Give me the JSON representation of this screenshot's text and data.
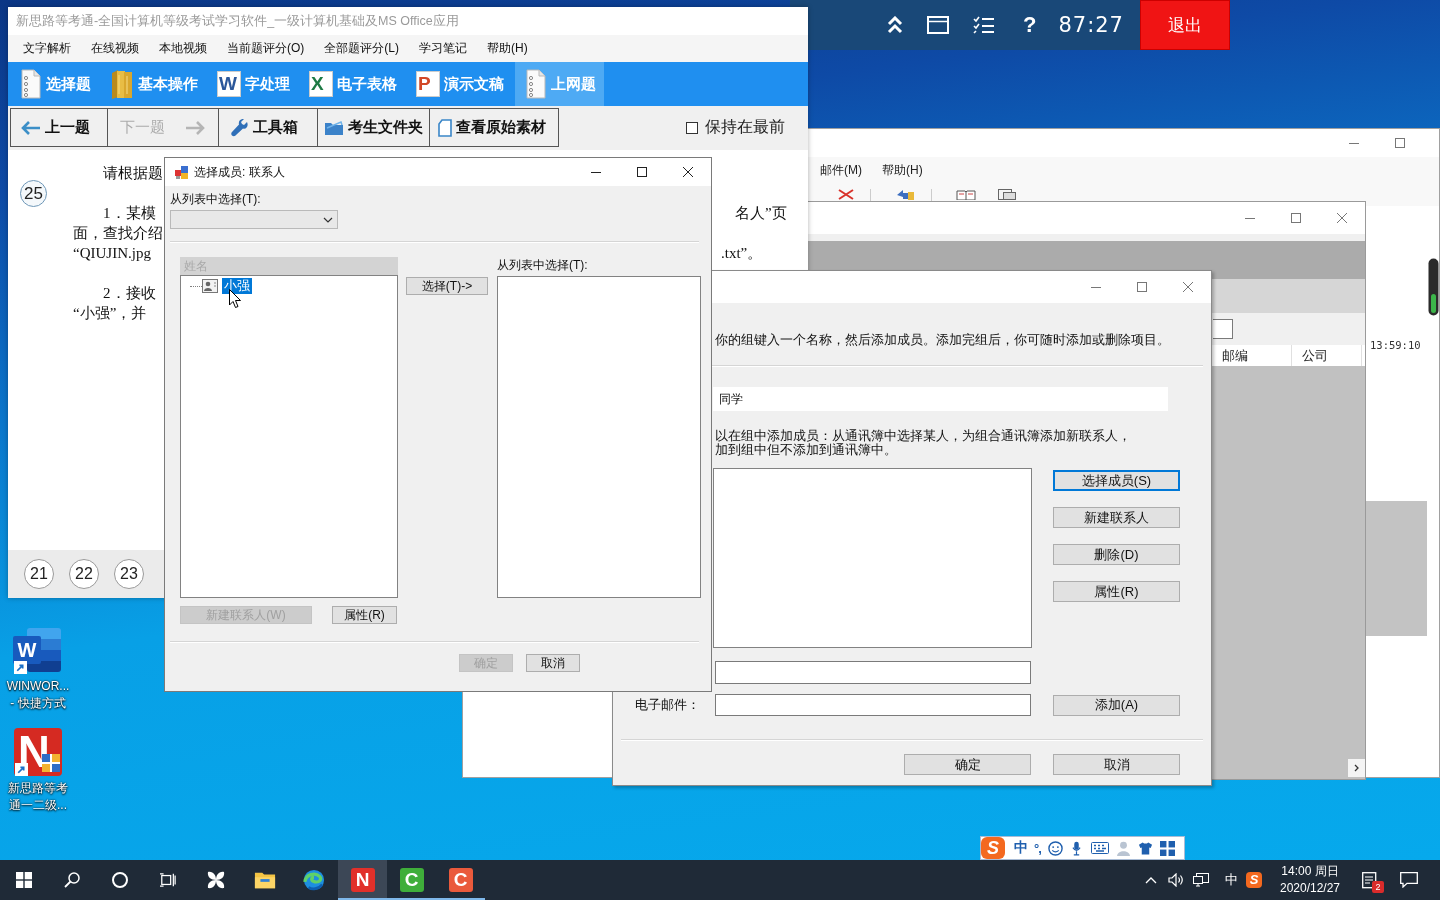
{
  "desktop": {
    "icons": [
      {
        "kind": "word",
        "glyph": "W",
        "lines": [
          "WINWOR...",
          "- 快捷方式"
        ]
      },
      {
        "kind": "exam-app",
        "glyph": "N",
        "lines": [
          "新思路等考",
          "通一二级..."
        ]
      }
    ]
  },
  "exam_bar": {
    "help": "?",
    "timer": "87:27",
    "exit": "退出"
  },
  "mail_window": {
    "menu": [
      "邮件(M)",
      "帮助(H)"
    ],
    "time": "13:59:10"
  },
  "address_book": {
    "columns": [
      "邮编",
      "公司"
    ]
  },
  "group_dialog": {
    "intro": "你的组键入一个名称，然后添加成员。添加完组后，你可随时添加或删除项目。",
    "name_value": "同学",
    "hint_lines": [
      "以在组中添加成员：从通讯簿中选择某人，为组合通讯簿添加新联系人，",
      "加到组中但不添加到通讯簿中。"
    ],
    "side_buttons": [
      {
        "label": "选择成员(S)",
        "focused": true
      },
      {
        "label": "新建联系人",
        "focused": false
      },
      {
        "label": "删除(D)",
        "focused": false
      },
      {
        "label": "属性(R)",
        "focused": false
      }
    ],
    "email_label": "电子邮件：",
    "add_button": "添加(A)",
    "footer_buttons": [
      "确定",
      "取消"
    ]
  },
  "app_window": {
    "title": "新思路等考通-全国计算机等级考试学习软件_一级计算机基础及MS Office应用",
    "menu": [
      "文字解析",
      "在线视频",
      "本地视频",
      "当前题评分(O)",
      "全部题评分(L)",
      "学习笔记",
      "帮助(H)"
    ],
    "tabs": [
      {
        "label": "选择题",
        "kind": "page",
        "selected": false
      },
      {
        "label": "基本操作",
        "kind": "folder",
        "selected": false
      },
      {
        "label": "字处理",
        "kind": "word",
        "glyph": "W",
        "selected": false
      },
      {
        "label": "电子表格",
        "kind": "excel",
        "glyph": "X",
        "selected": false
      },
      {
        "label": "演示文稿",
        "kind": "ppt",
        "glyph": "P",
        "selected": false
      },
      {
        "label": "上网题",
        "kind": "page",
        "selected": true
      }
    ],
    "toolbar": [
      {
        "label": "上一题",
        "kind": "prev",
        "disabled": false
      },
      {
        "label": "下一题",
        "kind": "next",
        "disabled": true
      },
      {
        "label": "工具箱",
        "kind": "tools",
        "disabled": false
      },
      {
        "label": "考生文件夹",
        "kind": "folder",
        "disabled": false
      },
      {
        "label": "查看原始素材",
        "kind": "source",
        "disabled": false
      }
    ],
    "keep_on_top": {
      "label": "保持在最前",
      "checked": false
    },
    "question": {
      "number": "25",
      "paragraphs": [
        [
          "请根据题"
        ],
        [
          "1．某模",
          "面，查找介绍",
          "“QIUJIN.jpg"
        ],
        [
          "2．接收",
          "“小强”，并"
        ]
      ],
      "right_fragments": [
        "名人”页",
        ".txt”。"
      ]
    },
    "nav": [
      "21",
      "22",
      "23"
    ]
  },
  "select_dialog": {
    "title": "选择成员: 联系人",
    "list_label": "从列表中选择(T):",
    "column": "姓名",
    "contacts": [
      {
        "name": "小强",
        "selected": true
      }
    ],
    "select_button": "选择(T)->",
    "members_label": "从列表中选择(T):",
    "buttons": [
      {
        "label": "新建联系人(W)",
        "disabled": true
      },
      {
        "label": "属性(R)",
        "disabled": false
      }
    ],
    "footer_buttons": [
      {
        "label": "确定",
        "disabled": true
      },
      {
        "label": "取消",
        "disabled": false
      }
    ]
  },
  "ime_bar": {
    "glyph": "S",
    "mode": "中",
    "punctuation": "°,"
  },
  "taskbar": {
    "apps": [
      {
        "kind": "folder",
        "running": false,
        "active": false
      },
      {
        "kind": "browser",
        "running": false,
        "active": false
      },
      {
        "kind": "tile",
        "glyph": "N",
        "color": "#e1302a",
        "running": true,
        "active": true
      },
      {
        "kind": "tile",
        "glyph": "C",
        "color": "#3fae3a",
        "running": true,
        "active": false
      },
      {
        "kind": "tile",
        "glyph": "C",
        "color": "#ea5a3c",
        "running": true,
        "active": false
      }
    ],
    "tray": {
      "language": "中",
      "ime_glyph": "S",
      "time": "14:00 周日",
      "date": "2020/12/27",
      "notifications": "2"
    }
  }
}
